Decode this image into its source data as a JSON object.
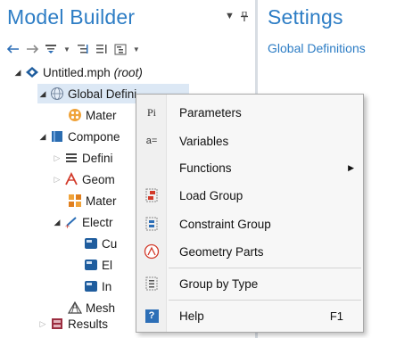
{
  "model_builder": {
    "title": "Model Builder",
    "tree": [
      {
        "label": "Untitled.mph",
        "suffix": "(root)"
      },
      {
        "label": "Global Defini"
      },
      {
        "label": "Mater"
      },
      {
        "label": "Compone"
      },
      {
        "label": "Defini"
      },
      {
        "label": "Geom"
      },
      {
        "label": "Mater"
      },
      {
        "label": "Electr"
      },
      {
        "label": "Cu"
      },
      {
        "label": "El"
      },
      {
        "label": "In"
      },
      {
        "label": "Mesh"
      },
      {
        "label": "Results"
      }
    ]
  },
  "settings": {
    "title": "Settings",
    "subtitle": "Global Definitions"
  },
  "context_menu": {
    "items": [
      {
        "label": "Parameters",
        "icon_text": "Pi"
      },
      {
        "label": "Variables",
        "icon_text": "a="
      },
      {
        "label": "Functions"
      },
      {
        "label": "Load Group"
      },
      {
        "label": "Constraint Group"
      },
      {
        "label": "Geometry Parts"
      },
      {
        "label": "Group by Type"
      },
      {
        "label": "Help",
        "icon_text": "?",
        "shortcut": "F1"
      }
    ]
  },
  "colors": {
    "accent": "#2d7dc5",
    "selection": "#dce8f5",
    "menu_bg": "#f7f7f7"
  },
  "icons": [
    "back-arrow-icon",
    "forward-arrow-icon",
    "show-icon",
    "expand-icon",
    "collapse-icon",
    "tree-view-icon",
    "pin-icon"
  ]
}
